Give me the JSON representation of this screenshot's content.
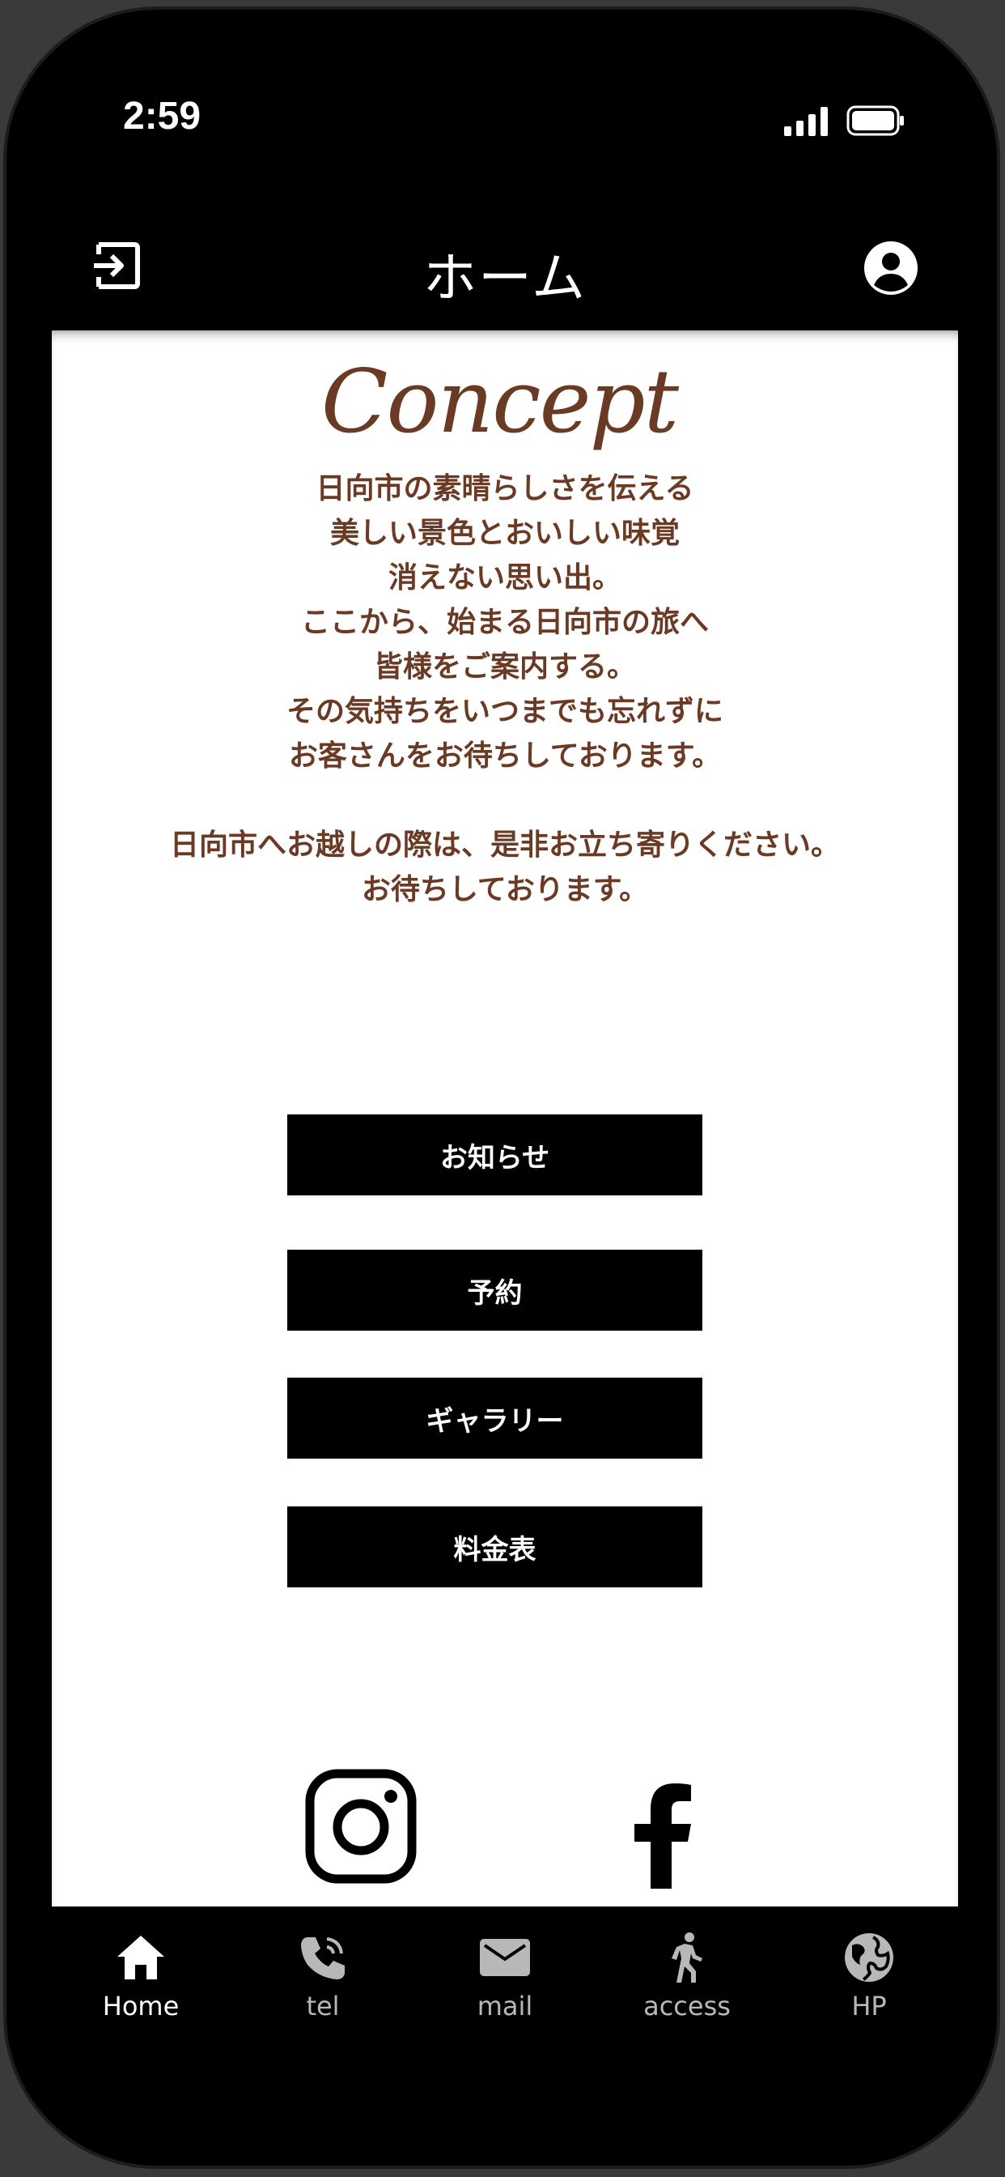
{
  "status_bar": {
    "time": "2:59"
  },
  "header": {
    "title": "ホーム",
    "logout_icon": "logout-icon",
    "account_icon": "account-circle-icon"
  },
  "concept": {
    "title": "Concept",
    "lines": [
      "日向市の素晴らしさを伝える",
      "美しい景色とおいしい味覚",
      "消えない思い出。",
      "ここから、始まる日向市の旅へ",
      "皆様をご案内する。",
      "その気持ちをいつまでも忘れずに",
      "お客さんをお待ちしております。",
      "",
      "日向市へお越しの際は、是非お立ち寄りください。",
      "お待ちしております。"
    ]
  },
  "menu_buttons": [
    "お知らせ",
    "予約",
    "ギャラリー",
    "料金表"
  ],
  "social": {
    "instagram_icon": "instagram-icon",
    "facebook_icon": "facebook-icon"
  },
  "tab_bar": {
    "tabs": [
      {
        "label": "Home",
        "icon": "home-icon",
        "active": true
      },
      {
        "label": "tel",
        "icon": "phone-icon",
        "active": false
      },
      {
        "label": "mail",
        "icon": "mail-icon",
        "active": false
      },
      {
        "label": "access",
        "icon": "walk-icon",
        "active": false
      },
      {
        "label": "HP",
        "icon": "globe-icon",
        "active": false
      }
    ]
  },
  "colors": {
    "accent_brown": "#6b3a25",
    "header_bg": "#000000",
    "button_bg": "#000000",
    "tab_active": "#ffffff",
    "tab_inactive": "#b8b8b8"
  }
}
